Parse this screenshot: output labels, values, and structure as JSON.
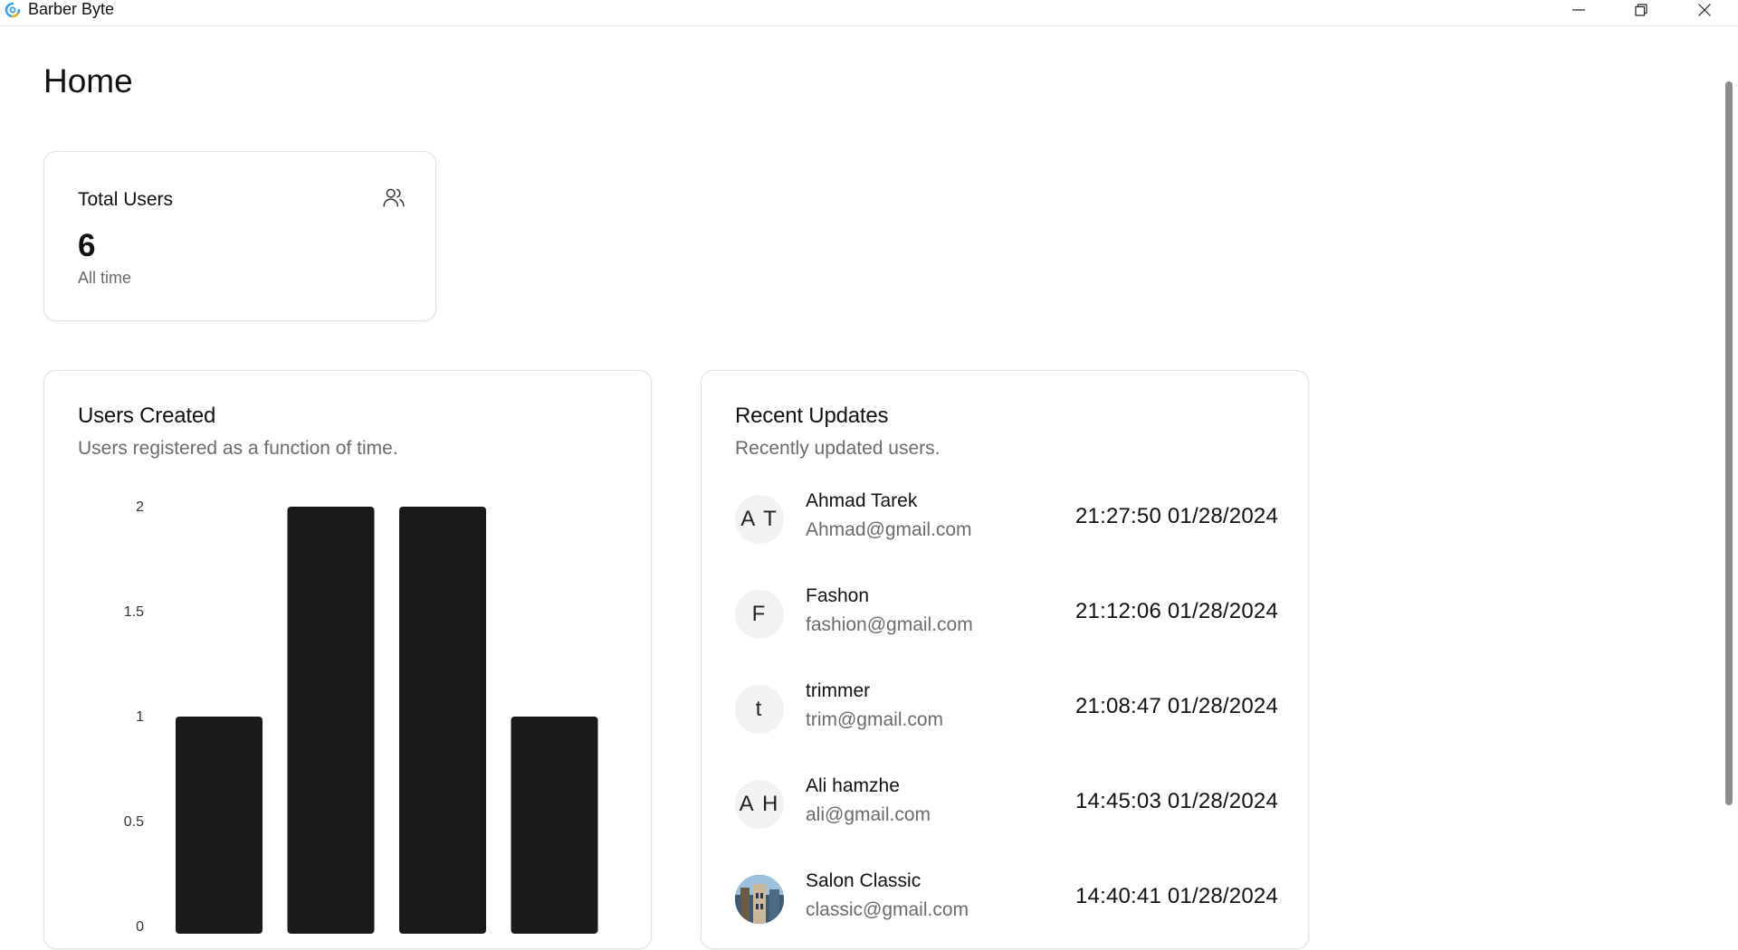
{
  "window": {
    "title": "Barber Byte"
  },
  "icons": {
    "app": "app-logo-icon",
    "minimize": "minimize-icon",
    "maximize": "restore-icon",
    "close": "close-icon",
    "users": "users-icon"
  },
  "colors": {
    "bar": "#1a1a1a",
    "muted_text": "#6b6b6b",
    "avatar_bg": "#f2f2f2"
  },
  "page": {
    "title": "Home"
  },
  "total_users": {
    "title": "Total Users",
    "value": "6",
    "subtitle": "All time"
  },
  "users_created": {
    "title": "Users Created",
    "subtitle": "Users registered as a function of time."
  },
  "chart_data": {
    "type": "bar",
    "title": "Users Created",
    "subtitle": "Users registered as a function of time.",
    "categories": [
      "",
      "",
      "",
      ""
    ],
    "values": [
      1,
      2,
      2,
      1
    ],
    "yticks": [
      "0",
      "0.5",
      "1",
      "1.5",
      "2"
    ],
    "ylim": [
      0,
      2
    ],
    "grid": false,
    "legend": "none"
  },
  "recent_updates": {
    "title": "Recent Updates",
    "subtitle": "Recently updated users.",
    "items": [
      {
        "initials": "A T",
        "name": "Ahmad Tarek",
        "email": "Ahmad@gmail.com",
        "time": "21:27:50 01/28/2024"
      },
      {
        "initials": "F",
        "name": "Fashon",
        "email": "fashion@gmail.com",
        "time": "21:12:06 01/28/2024"
      },
      {
        "initials": "t",
        "name": "trimmer",
        "email": "trim@gmail.com",
        "time": "21:08:47 01/28/2024"
      },
      {
        "initials": "A H",
        "name": "Ali hamzhe",
        "email": "ali@gmail.com",
        "time": "14:45:03 01/28/2024"
      },
      {
        "initials": "",
        "name": "Salon Classic",
        "email": "classic@gmail.com",
        "time": "14:40:41 01/28/2024"
      }
    ]
  }
}
